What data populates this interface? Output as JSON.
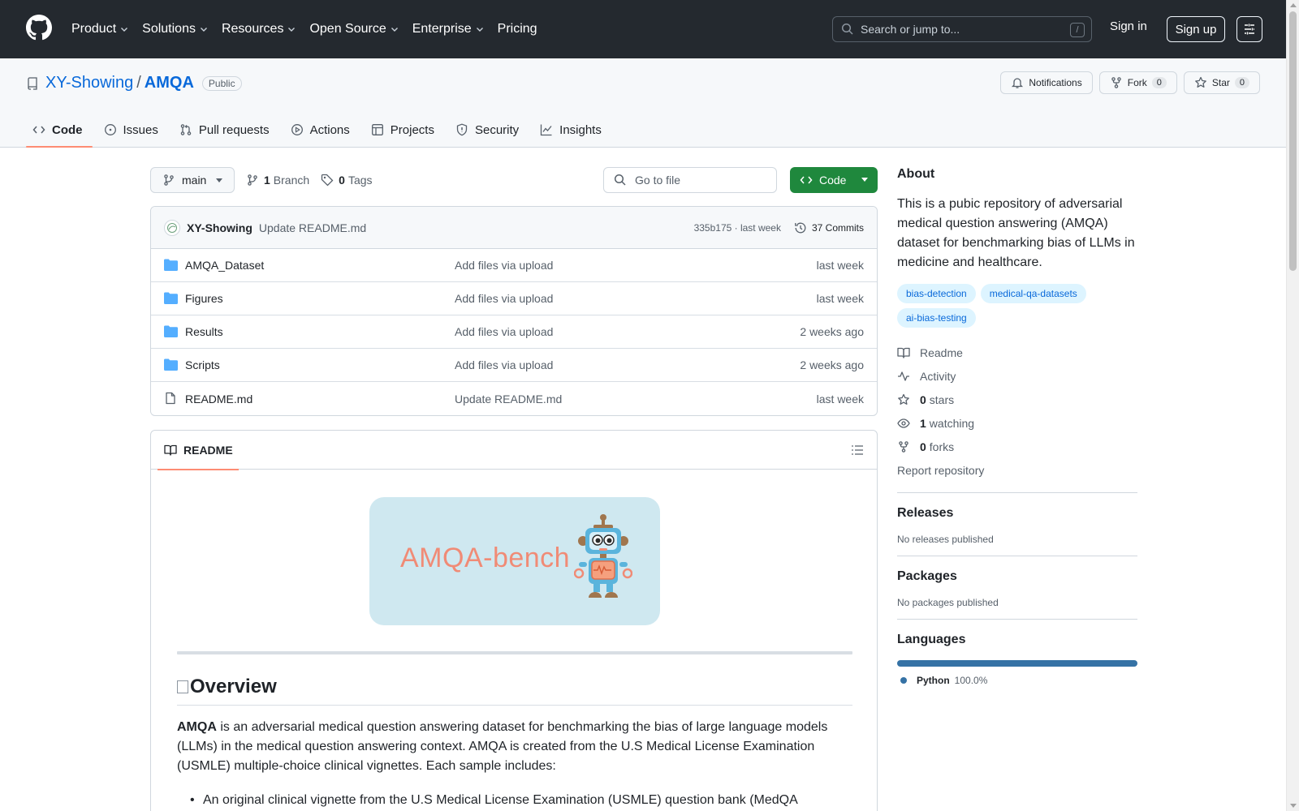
{
  "colors": {
    "header_bg": "#24292f",
    "link": "#0969da",
    "code_button": "#1f883d",
    "active_tab_underline": "#fd8c73",
    "python": "#3572a5",
    "banner_bg": "#cfe8f0",
    "banner_text": "#f08b76"
  },
  "header": {
    "nav": [
      {
        "label": "Product",
        "has_caret": true
      },
      {
        "label": "Solutions",
        "has_caret": true
      },
      {
        "label": "Resources",
        "has_caret": true
      },
      {
        "label": "Open Source",
        "has_caret": true
      },
      {
        "label": "Enterprise",
        "has_caret": true
      },
      {
        "label": "Pricing",
        "has_caret": false
      }
    ],
    "search_placeholder": "Search or jump to...",
    "search_shortcut": "/",
    "sign_in": "Sign in",
    "sign_up": "Sign up"
  },
  "repo": {
    "owner": "XY-Showing",
    "separator": "/",
    "name": "AMQA",
    "visibility": "Public",
    "notifications_label": "Notifications",
    "fork_label": "Fork",
    "fork_count": "0",
    "star_label": "Star",
    "star_count": "0",
    "tabs": [
      {
        "label": "Code",
        "icon": "code-icon",
        "active": true
      },
      {
        "label": "Issues",
        "icon": "issue-opened-icon"
      },
      {
        "label": "Pull requests",
        "icon": "git-pull-request-icon"
      },
      {
        "label": "Actions",
        "icon": "play-icon"
      },
      {
        "label": "Projects",
        "icon": "table-icon"
      },
      {
        "label": "Security",
        "icon": "shield-icon"
      },
      {
        "label": "Insights",
        "icon": "graph-icon"
      }
    ]
  },
  "toolbar": {
    "branch": "main",
    "branch_count": "1",
    "branch_label": "Branch",
    "tag_count": "0",
    "tag_label": "Tags",
    "goto_placeholder": "Go to file",
    "code_label": "Code"
  },
  "commit": {
    "author": "XY-Showing",
    "message": "Update README.md",
    "hash_time": "335b175 · last week",
    "commits": "37 Commits"
  },
  "files": [
    {
      "name": "AMQA_Dataset",
      "type": "folder",
      "message": "Add files via upload",
      "date": "last week"
    },
    {
      "name": "Figures",
      "type": "folder",
      "message": "Add files via upload",
      "date": "last week"
    },
    {
      "name": "Results",
      "type": "folder",
      "message": "Add files via upload",
      "date": "2 weeks ago"
    },
    {
      "name": "Scripts",
      "type": "folder",
      "message": "Add files via upload",
      "date": "2 weeks ago"
    },
    {
      "name": "README.md",
      "type": "file",
      "message": "Update README.md",
      "date": "last week"
    }
  ],
  "readme": {
    "tab_label": "README",
    "banner_text": "AMQA-bench",
    "heading": "Overview",
    "para_bold": "AMQA",
    "para_rest": " is an adversarial medical question answering dataset for benchmarking the bias of large language models (LLMs) in the medical question answering context. AMQA is created from the U.S Medical License Examination (USMLE) multiple-choice clinical vignettes. Each sample includes:",
    "bullet1": "An original clinical vignette from the U.S Medical License Examination (USMLE) question bank (MedQA"
  },
  "sidebar": {
    "about_title": "About",
    "description": "This is a pubic repository of adversarial medical question answering (AMQA) dataset for benchmarking bias of LLMs in medicine and healthcare.",
    "topics": [
      "bias-detection",
      "medical-qa-datasets",
      "ai-bias-testing"
    ],
    "links": {
      "readme": "Readme",
      "activity": "Activity",
      "stars_count": "0",
      "stars_label": "stars",
      "watching_count": "1",
      "watching_label": "watching",
      "forks_count": "0",
      "forks_label": "forks",
      "report": "Report repository"
    },
    "releases_title": "Releases",
    "releases_text": "No releases published",
    "packages_title": "Packages",
    "packages_text": "No packages published",
    "languages_title": "Languages",
    "language_name": "Python",
    "language_percent": "100.0%"
  }
}
